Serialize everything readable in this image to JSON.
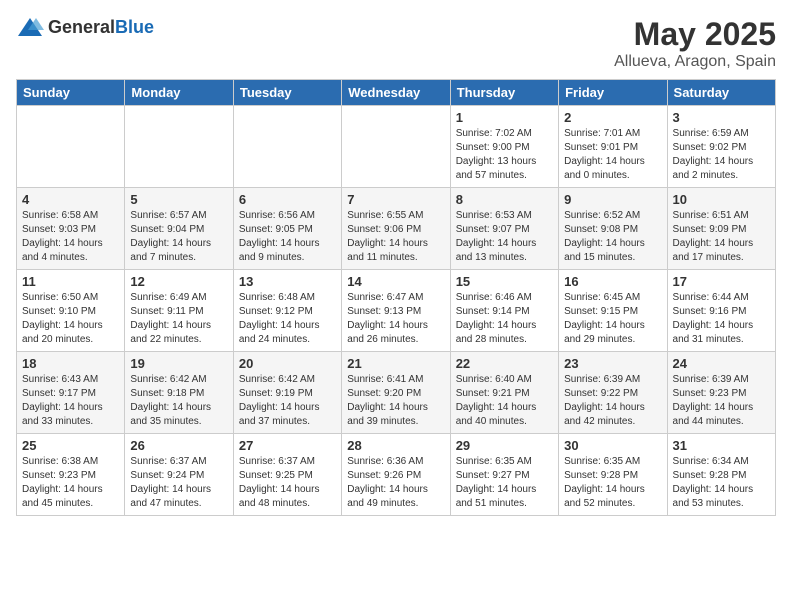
{
  "header": {
    "logo_general": "General",
    "logo_blue": "Blue",
    "month": "May 2025",
    "location": "Allueva, Aragon, Spain"
  },
  "weekdays": [
    "Sunday",
    "Monday",
    "Tuesday",
    "Wednesday",
    "Thursday",
    "Friday",
    "Saturday"
  ],
  "rows": [
    [
      {
        "day": "",
        "sunrise": "",
        "sunset": "",
        "daylight": ""
      },
      {
        "day": "",
        "sunrise": "",
        "sunset": "",
        "daylight": ""
      },
      {
        "day": "",
        "sunrise": "",
        "sunset": "",
        "daylight": ""
      },
      {
        "day": "",
        "sunrise": "",
        "sunset": "",
        "daylight": ""
      },
      {
        "day": "1",
        "sunrise": "7:02 AM",
        "sunset": "9:00 PM",
        "daylight": "13 hours and 57 minutes."
      },
      {
        "day": "2",
        "sunrise": "7:01 AM",
        "sunset": "9:01 PM",
        "daylight": "14 hours and 0 minutes."
      },
      {
        "day": "3",
        "sunrise": "6:59 AM",
        "sunset": "9:02 PM",
        "daylight": "14 hours and 2 minutes."
      }
    ],
    [
      {
        "day": "4",
        "sunrise": "6:58 AM",
        "sunset": "9:03 PM",
        "daylight": "14 hours and 4 minutes."
      },
      {
        "day": "5",
        "sunrise": "6:57 AM",
        "sunset": "9:04 PM",
        "daylight": "14 hours and 7 minutes."
      },
      {
        "day": "6",
        "sunrise": "6:56 AM",
        "sunset": "9:05 PM",
        "daylight": "14 hours and 9 minutes."
      },
      {
        "day": "7",
        "sunrise": "6:55 AM",
        "sunset": "9:06 PM",
        "daylight": "14 hours and 11 minutes."
      },
      {
        "day": "8",
        "sunrise": "6:53 AM",
        "sunset": "9:07 PM",
        "daylight": "14 hours and 13 minutes."
      },
      {
        "day": "9",
        "sunrise": "6:52 AM",
        "sunset": "9:08 PM",
        "daylight": "14 hours and 15 minutes."
      },
      {
        "day": "10",
        "sunrise": "6:51 AM",
        "sunset": "9:09 PM",
        "daylight": "14 hours and 17 minutes."
      }
    ],
    [
      {
        "day": "11",
        "sunrise": "6:50 AM",
        "sunset": "9:10 PM",
        "daylight": "14 hours and 20 minutes."
      },
      {
        "day": "12",
        "sunrise": "6:49 AM",
        "sunset": "9:11 PM",
        "daylight": "14 hours and 22 minutes."
      },
      {
        "day": "13",
        "sunrise": "6:48 AM",
        "sunset": "9:12 PM",
        "daylight": "14 hours and 24 minutes."
      },
      {
        "day": "14",
        "sunrise": "6:47 AM",
        "sunset": "9:13 PM",
        "daylight": "14 hours and 26 minutes."
      },
      {
        "day": "15",
        "sunrise": "6:46 AM",
        "sunset": "9:14 PM",
        "daylight": "14 hours and 28 minutes."
      },
      {
        "day": "16",
        "sunrise": "6:45 AM",
        "sunset": "9:15 PM",
        "daylight": "14 hours and 29 minutes."
      },
      {
        "day": "17",
        "sunrise": "6:44 AM",
        "sunset": "9:16 PM",
        "daylight": "14 hours and 31 minutes."
      }
    ],
    [
      {
        "day": "18",
        "sunrise": "6:43 AM",
        "sunset": "9:17 PM",
        "daylight": "14 hours and 33 minutes."
      },
      {
        "day": "19",
        "sunrise": "6:42 AM",
        "sunset": "9:18 PM",
        "daylight": "14 hours and 35 minutes."
      },
      {
        "day": "20",
        "sunrise": "6:42 AM",
        "sunset": "9:19 PM",
        "daylight": "14 hours and 37 minutes."
      },
      {
        "day": "21",
        "sunrise": "6:41 AM",
        "sunset": "9:20 PM",
        "daylight": "14 hours and 39 minutes."
      },
      {
        "day": "22",
        "sunrise": "6:40 AM",
        "sunset": "9:21 PM",
        "daylight": "14 hours and 40 minutes."
      },
      {
        "day": "23",
        "sunrise": "6:39 AM",
        "sunset": "9:22 PM",
        "daylight": "14 hours and 42 minutes."
      },
      {
        "day": "24",
        "sunrise": "6:39 AM",
        "sunset": "9:23 PM",
        "daylight": "14 hours and 44 minutes."
      }
    ],
    [
      {
        "day": "25",
        "sunrise": "6:38 AM",
        "sunset": "9:23 PM",
        "daylight": "14 hours and 45 minutes."
      },
      {
        "day": "26",
        "sunrise": "6:37 AM",
        "sunset": "9:24 PM",
        "daylight": "14 hours and 47 minutes."
      },
      {
        "day": "27",
        "sunrise": "6:37 AM",
        "sunset": "9:25 PM",
        "daylight": "14 hours and 48 minutes."
      },
      {
        "day": "28",
        "sunrise": "6:36 AM",
        "sunset": "9:26 PM",
        "daylight": "14 hours and 49 minutes."
      },
      {
        "day": "29",
        "sunrise": "6:35 AM",
        "sunset": "9:27 PM",
        "daylight": "14 hours and 51 minutes."
      },
      {
        "day": "30",
        "sunrise": "6:35 AM",
        "sunset": "9:28 PM",
        "daylight": "14 hours and 52 minutes."
      },
      {
        "day": "31",
        "sunrise": "6:34 AM",
        "sunset": "9:28 PM",
        "daylight": "14 hours and 53 minutes."
      }
    ]
  ]
}
